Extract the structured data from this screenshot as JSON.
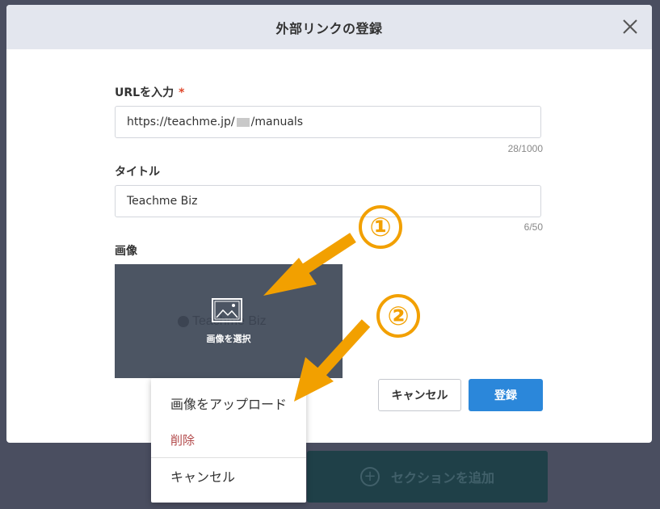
{
  "background": {
    "add_section_label": "セクションを追加"
  },
  "modal": {
    "title": "外部リンクの登録",
    "close_icon": "close-icon",
    "url": {
      "label": "URLを入力",
      "required_mark": "*",
      "value_prefix": "https://teachme.jp/",
      "value_suffix": "/manuals",
      "counter": "28/1000"
    },
    "title_field": {
      "label": "タイトル",
      "value": "Teachme Biz",
      "counter": "6/50"
    },
    "image": {
      "label": "画像",
      "watermark": "Teachme Biz",
      "select_label": "画像を選択",
      "icon": "image-icon"
    },
    "buttons": {
      "cancel": "キャンセル",
      "register": "登録"
    }
  },
  "menu": {
    "items": [
      {
        "label": "画像をアップロード"
      },
      {
        "label": "削除"
      },
      {
        "label": "キャンセル"
      }
    ]
  },
  "annotations": {
    "badge_1": "①",
    "badge_2": "②",
    "accent_color": "#f2a000"
  }
}
